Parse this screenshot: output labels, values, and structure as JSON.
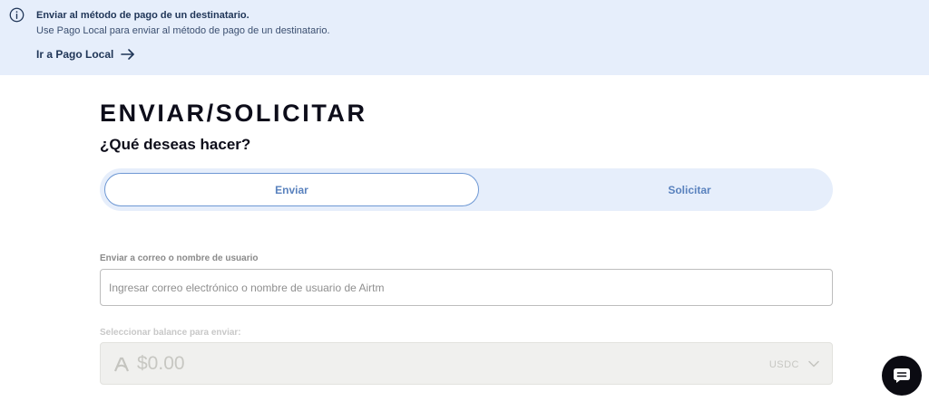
{
  "banner": {
    "title": "Enviar al método de pago de un destinatario.",
    "text": "Use Pago Local para enviar al método de pago de un destinatario.",
    "link_label": "Ir a Pago Local",
    "bg_color": "#e6eefb"
  },
  "header": {
    "title": "ENVIAR/SOLICITAR",
    "subtitle": "¿Qué deseas hacer?"
  },
  "mode_toggle": {
    "options": [
      {
        "label": "Enviar",
        "selected": true
      },
      {
        "label": "Solicitar",
        "selected": false
      }
    ],
    "accent_color": "#5a82be"
  },
  "recipient": {
    "label": "Enviar a correo o nombre de usuario",
    "placeholder": "Ingresar correo electrónico o nombre de usuario de Airtm",
    "value": ""
  },
  "balance": {
    "label": "Seleccionar balance para enviar:",
    "amount": "$0.00",
    "currency": "USDC",
    "disabled": true
  },
  "icons": {
    "info": "info-icon",
    "arrow": "arrow-right-icon",
    "airtm": "airtm-logo-icon",
    "chevron": "chevron-down-icon",
    "chat": "chat-icon"
  }
}
